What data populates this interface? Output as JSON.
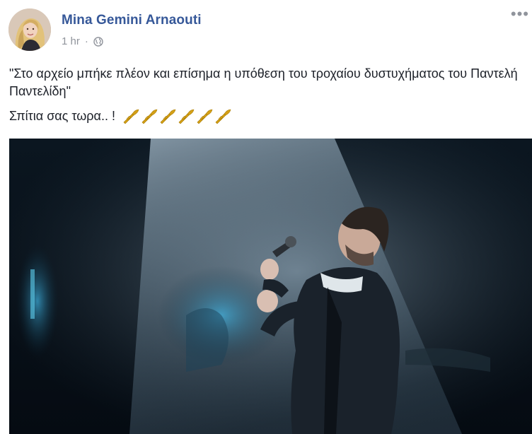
{
  "post": {
    "author": "Mina Gemini Arnaouti",
    "time": "1 hr",
    "separator": "·",
    "privacy_icon": "globe-icon",
    "more_icon": "ellipsis-icon",
    "text_line1": "\"Στο αρχείο μπήκε πλέον και επίσημα η υπόθεση του τροχαίου δυστυχήματος του Παντελή Παντελίδη\"",
    "text_line2": "Σπίτια σας τωρα.. !",
    "emoji": "trumpet-icon",
    "emoji_count": 6
  },
  "colors": {
    "author": "#365899",
    "meta": "#90949c",
    "text": "#1d2129"
  }
}
